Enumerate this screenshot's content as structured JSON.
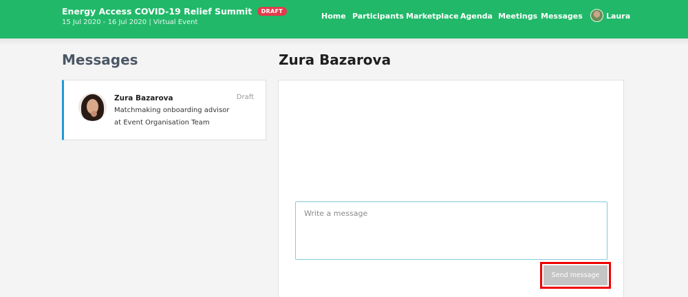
{
  "header": {
    "event_title": "Energy Access COVID-19 Relief Summit",
    "badge": "DRAFT",
    "event_subtitle": "15 Jul 2020 - 16 Jul 2020 | Virtual Event",
    "nav": [
      "Home",
      "Participants",
      "Marketplace",
      "Agenda",
      "Meetings",
      "Messages"
    ],
    "user_name": "Laura",
    "colors": {
      "brand": "#21b969",
      "badge": "#e23b4e"
    }
  },
  "sidebar": {
    "heading": "Messages",
    "conversations": [
      {
        "name": "Zura Bazarova",
        "status": "Draft",
        "line1": "Matchmaking onboarding advisor",
        "line2": "at Event Organisation Team",
        "accent": "#1e9ad6"
      }
    ]
  },
  "conversation": {
    "heading": "Zura Bazarova",
    "input_placeholder": "Write a message",
    "input_value": "",
    "send_label": "Send message"
  }
}
